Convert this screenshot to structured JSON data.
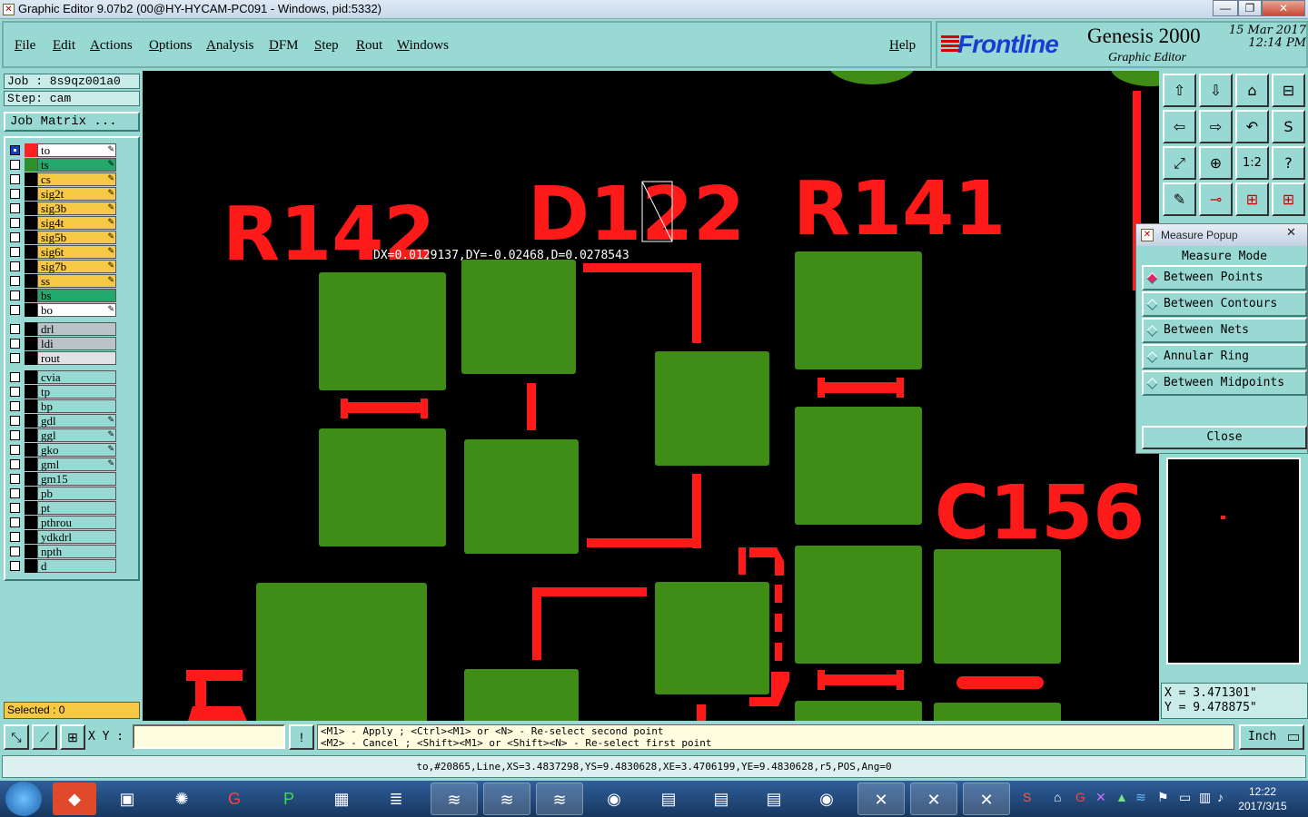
{
  "window": {
    "title": "Graphic Editor 9.07b2 (00@HY-HYCAM-PC091 - Windows, pid:5332)",
    "minimize": "—",
    "maximize": "❐",
    "close": "✕"
  },
  "menu": {
    "items": [
      "File",
      "Edit",
      "Actions",
      "Options",
      "Analysis",
      "DFM",
      "Step",
      "Rout",
      "Windows"
    ],
    "help": "Help"
  },
  "brand": {
    "logo": "Frontline",
    "product": "Genesis 2000",
    "subtitle": "Graphic Editor",
    "date": "15 Mar 2017",
    "time": "12:14 PM"
  },
  "left": {
    "job": "Job : 8s9qz001a0",
    "step": "Step: cam",
    "job_matrix": "Job Matrix ...",
    "selected": "Selected : 0",
    "layers": [
      {
        "name": "to",
        "color": "#ffffff",
        "swatch": "#ff2020",
        "on": true,
        "edit": true
      },
      {
        "name": "ts",
        "color": "#22a86a",
        "swatch": "#2f8f2f",
        "on": false,
        "edit": true
      },
      {
        "name": "cs",
        "color": "#f6c843",
        "swatch": "#000000",
        "on": false,
        "edit": true
      },
      {
        "name": "sig2t",
        "color": "#f6c843",
        "swatch": "#000000",
        "on": false,
        "edit": true
      },
      {
        "name": "sig3b",
        "color": "#f6c843",
        "swatch": "#000000",
        "on": false,
        "edit": true
      },
      {
        "name": "sig4t",
        "color": "#f6c843",
        "swatch": "#000000",
        "on": false,
        "edit": true
      },
      {
        "name": "sig5b",
        "color": "#f6c843",
        "swatch": "#000000",
        "on": false,
        "edit": true
      },
      {
        "name": "sig6t",
        "color": "#f6c843",
        "swatch": "#000000",
        "on": false,
        "edit": true
      },
      {
        "name": "sig7b",
        "color": "#f6c843",
        "swatch": "#000000",
        "on": false,
        "edit": true
      },
      {
        "name": "ss",
        "color": "#f6c843",
        "swatch": "#000000",
        "on": false,
        "edit": true
      },
      {
        "name": "bs",
        "color": "#22a86a",
        "swatch": "#000000",
        "on": false,
        "edit": false
      },
      {
        "name": "bo",
        "color": "#ffffff",
        "swatch": "#000000",
        "on": false,
        "edit": true
      },
      {
        "name": "drl",
        "color": "#b9c4c9",
        "swatch": "#000000",
        "on": false,
        "edit": false,
        "gap": true
      },
      {
        "name": "ldi",
        "color": "#b9c4c9",
        "swatch": "#000000",
        "on": false,
        "edit": false
      },
      {
        "name": "rout",
        "color": "#dfe3e5",
        "swatch": "#000000",
        "on": false,
        "edit": false
      },
      {
        "name": "cvia",
        "color": "#99d9d4",
        "swatch": "#000000",
        "on": false,
        "edit": false,
        "gap": true
      },
      {
        "name": "tp",
        "color": "#99d9d4",
        "swatch": "#000000",
        "on": false,
        "edit": false
      },
      {
        "name": "bp",
        "color": "#99d9d4",
        "swatch": "#000000",
        "on": false,
        "edit": false
      },
      {
        "name": "gdl",
        "color": "#99d9d4",
        "swatch": "#000000",
        "on": false,
        "edit": true
      },
      {
        "name": "ggl",
        "color": "#99d9d4",
        "swatch": "#000000",
        "on": false,
        "edit": true
      },
      {
        "name": "gko",
        "color": "#99d9d4",
        "swatch": "#000000",
        "on": false,
        "edit": true
      },
      {
        "name": "gml",
        "color": "#99d9d4",
        "swatch": "#000000",
        "on": false,
        "edit": true
      },
      {
        "name": "gm15",
        "color": "#99d9d4",
        "swatch": "#000000",
        "on": false,
        "edit": false
      },
      {
        "name": "pb",
        "color": "#99d9d4",
        "swatch": "#000000",
        "on": false,
        "edit": false
      },
      {
        "name": "pt",
        "color": "#99d9d4",
        "swatch": "#000000",
        "on": false,
        "edit": false
      },
      {
        "name": "pthrou",
        "color": "#99d9d4",
        "swatch": "#000000",
        "on": false,
        "edit": false
      },
      {
        "name": "ydkdrl",
        "color": "#99d9d4",
        "swatch": "#000000",
        "on": false,
        "edit": false
      },
      {
        "name": "npth",
        "color": "#99d9d4",
        "swatch": "#000000",
        "on": false,
        "edit": false
      },
      {
        "name": "d",
        "color": "#99d9d4",
        "swatch": "#000000",
        "on": false,
        "edit": false
      }
    ]
  },
  "canvas": {
    "labels": [
      "R142",
      "D122",
      "R141",
      "C156"
    ],
    "measure_readout": "DX=0.0129137,DY=-0.02468,D=0.0278543",
    "pad_color": "#3f8d16",
    "silk_color": "#ff1a1a"
  },
  "tools": {
    "buttons": [
      "⇧",
      "⇩",
      "⌂",
      "⊟",
      "⇦",
      "⇨",
      "↶",
      "S",
      "⤢",
      "⊕",
      "1:2",
      "?",
      "✎",
      "⊸",
      "⊞",
      "⊞"
    ]
  },
  "measure": {
    "title": "Measure Popup",
    "mode_label": "Measure Mode",
    "options": [
      {
        "label": "Between Points",
        "selected": true
      },
      {
        "label": "Between Contours",
        "selected": false
      },
      {
        "label": "Between Nets",
        "selected": false
      },
      {
        "label": "Annular Ring",
        "selected": false
      },
      {
        "label": "Between Midpoints",
        "selected": false
      }
    ],
    "close": "Close"
  },
  "coords": {
    "x": "X = 3.471301\"",
    "y": "Y = 9.478875\""
  },
  "bottom": {
    "xy_label": "X Y :",
    "xy_value": "",
    "hint_line1": "<M1> - Apply  ; <Ctrl><M1> or <N> - Re-select second point",
    "hint_line2": "<M2> - Cancel ; <Shift><M1> or <Shift><N> - Re-select first point",
    "unit": "Inch",
    "alert": "!"
  },
  "status": "to,#20865,Line,XS=3.4837298,YS=9.4830628,XE=3.4706199,YE=9.4830628,r5,POS,Ang=0",
  "taskbar": {
    "clock_time": "12:22",
    "clock_date": "2017/3/15"
  }
}
